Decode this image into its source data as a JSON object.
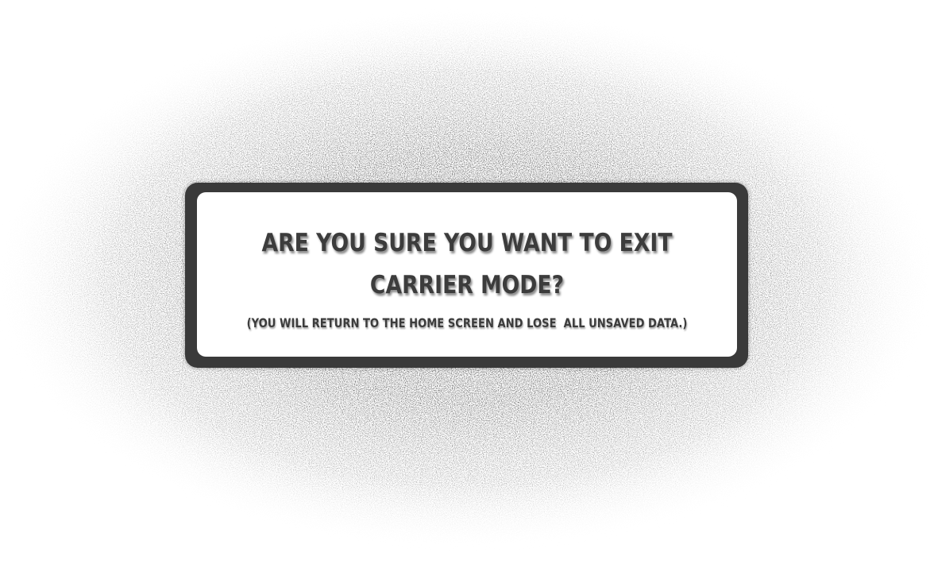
{
  "dialog": {
    "title_line1": "ARE YOU SURE YOU WANT TO EXIT",
    "title_line2": "CARRIER MODE?",
    "subtitle": "(YOU WILL RETURN TO THE HOME SCREEN AND LOSE  ALL UNSAVED DATA.)"
  },
  "colors": {
    "frame": "#3a3a3a",
    "panel": "#ffffff",
    "text": "#3c3c3c",
    "halo": "#2a2a2a"
  }
}
